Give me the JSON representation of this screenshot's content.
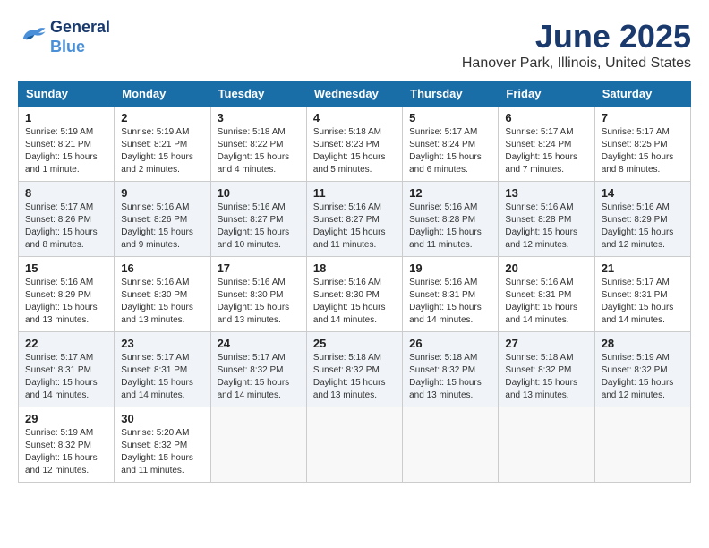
{
  "header": {
    "logo_line1": "General",
    "logo_line2": "Blue",
    "month_title": "June 2025",
    "location": "Hanover Park, Illinois, United States"
  },
  "days_of_week": [
    "Sunday",
    "Monday",
    "Tuesday",
    "Wednesday",
    "Thursday",
    "Friday",
    "Saturday"
  ],
  "weeks": [
    [
      {
        "day": "1",
        "info": "Sunrise: 5:19 AM\nSunset: 8:21 PM\nDaylight: 15 hours\nand 1 minute."
      },
      {
        "day": "2",
        "info": "Sunrise: 5:19 AM\nSunset: 8:21 PM\nDaylight: 15 hours\nand 2 minutes."
      },
      {
        "day": "3",
        "info": "Sunrise: 5:18 AM\nSunset: 8:22 PM\nDaylight: 15 hours\nand 4 minutes."
      },
      {
        "day": "4",
        "info": "Sunrise: 5:18 AM\nSunset: 8:23 PM\nDaylight: 15 hours\nand 5 minutes."
      },
      {
        "day": "5",
        "info": "Sunrise: 5:17 AM\nSunset: 8:24 PM\nDaylight: 15 hours\nand 6 minutes."
      },
      {
        "day": "6",
        "info": "Sunrise: 5:17 AM\nSunset: 8:24 PM\nDaylight: 15 hours\nand 7 minutes."
      },
      {
        "day": "7",
        "info": "Sunrise: 5:17 AM\nSunset: 8:25 PM\nDaylight: 15 hours\nand 8 minutes."
      }
    ],
    [
      {
        "day": "8",
        "info": "Sunrise: 5:17 AM\nSunset: 8:26 PM\nDaylight: 15 hours\nand 8 minutes."
      },
      {
        "day": "9",
        "info": "Sunrise: 5:16 AM\nSunset: 8:26 PM\nDaylight: 15 hours\nand 9 minutes."
      },
      {
        "day": "10",
        "info": "Sunrise: 5:16 AM\nSunset: 8:27 PM\nDaylight: 15 hours\nand 10 minutes."
      },
      {
        "day": "11",
        "info": "Sunrise: 5:16 AM\nSunset: 8:27 PM\nDaylight: 15 hours\nand 11 minutes."
      },
      {
        "day": "12",
        "info": "Sunrise: 5:16 AM\nSunset: 8:28 PM\nDaylight: 15 hours\nand 11 minutes."
      },
      {
        "day": "13",
        "info": "Sunrise: 5:16 AM\nSunset: 8:28 PM\nDaylight: 15 hours\nand 12 minutes."
      },
      {
        "day": "14",
        "info": "Sunrise: 5:16 AM\nSunset: 8:29 PM\nDaylight: 15 hours\nand 12 minutes."
      }
    ],
    [
      {
        "day": "15",
        "info": "Sunrise: 5:16 AM\nSunset: 8:29 PM\nDaylight: 15 hours\nand 13 minutes."
      },
      {
        "day": "16",
        "info": "Sunrise: 5:16 AM\nSunset: 8:30 PM\nDaylight: 15 hours\nand 13 minutes."
      },
      {
        "day": "17",
        "info": "Sunrise: 5:16 AM\nSunset: 8:30 PM\nDaylight: 15 hours\nand 13 minutes."
      },
      {
        "day": "18",
        "info": "Sunrise: 5:16 AM\nSunset: 8:30 PM\nDaylight: 15 hours\nand 14 minutes."
      },
      {
        "day": "19",
        "info": "Sunrise: 5:16 AM\nSunset: 8:31 PM\nDaylight: 15 hours\nand 14 minutes."
      },
      {
        "day": "20",
        "info": "Sunrise: 5:16 AM\nSunset: 8:31 PM\nDaylight: 15 hours\nand 14 minutes."
      },
      {
        "day": "21",
        "info": "Sunrise: 5:17 AM\nSunset: 8:31 PM\nDaylight: 15 hours\nand 14 minutes."
      }
    ],
    [
      {
        "day": "22",
        "info": "Sunrise: 5:17 AM\nSunset: 8:31 PM\nDaylight: 15 hours\nand 14 minutes."
      },
      {
        "day": "23",
        "info": "Sunrise: 5:17 AM\nSunset: 8:31 PM\nDaylight: 15 hours\nand 14 minutes."
      },
      {
        "day": "24",
        "info": "Sunrise: 5:17 AM\nSunset: 8:32 PM\nDaylight: 15 hours\nand 14 minutes."
      },
      {
        "day": "25",
        "info": "Sunrise: 5:18 AM\nSunset: 8:32 PM\nDaylight: 15 hours\nand 13 minutes."
      },
      {
        "day": "26",
        "info": "Sunrise: 5:18 AM\nSunset: 8:32 PM\nDaylight: 15 hours\nand 13 minutes."
      },
      {
        "day": "27",
        "info": "Sunrise: 5:18 AM\nSunset: 8:32 PM\nDaylight: 15 hours\nand 13 minutes."
      },
      {
        "day": "28",
        "info": "Sunrise: 5:19 AM\nSunset: 8:32 PM\nDaylight: 15 hours\nand 12 minutes."
      }
    ],
    [
      {
        "day": "29",
        "info": "Sunrise: 5:19 AM\nSunset: 8:32 PM\nDaylight: 15 hours\nand 12 minutes."
      },
      {
        "day": "30",
        "info": "Sunrise: 5:20 AM\nSunset: 8:32 PM\nDaylight: 15 hours\nand 11 minutes."
      },
      {
        "day": "",
        "info": ""
      },
      {
        "day": "",
        "info": ""
      },
      {
        "day": "",
        "info": ""
      },
      {
        "day": "",
        "info": ""
      },
      {
        "day": "",
        "info": ""
      }
    ]
  ]
}
